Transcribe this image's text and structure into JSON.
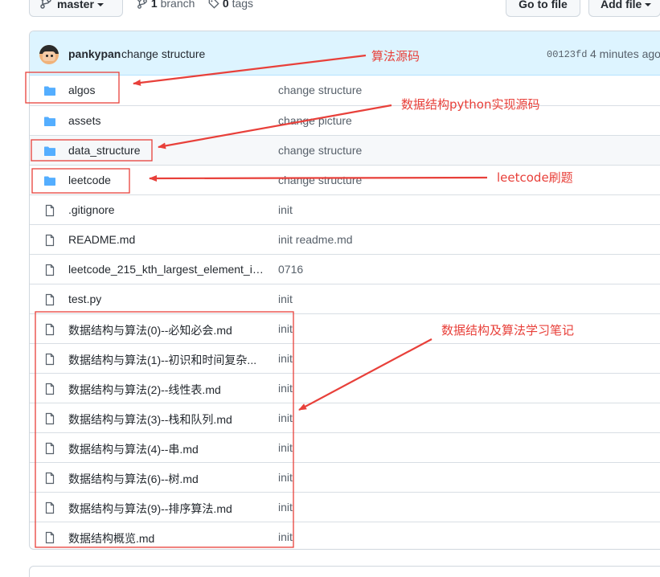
{
  "toolbar": {
    "branch": "master",
    "branch_count": "1",
    "branch_word": "branch",
    "tag_count": "0",
    "tag_word": "tags",
    "go_to_file": "Go to file",
    "add_file": "Add file"
  },
  "commit": {
    "author": "pankypan",
    "message": "change structure",
    "sha": "00123fd",
    "time": "4 minutes ago"
  },
  "files": [
    {
      "name": "algos",
      "type": "dir",
      "message": "change structure"
    },
    {
      "name": "assets",
      "type": "dir",
      "message": "change picture"
    },
    {
      "name": "data_structure",
      "type": "dir",
      "message": "change structure"
    },
    {
      "name": "leetcode",
      "type": "dir",
      "message": "change structure"
    },
    {
      "name": ".gitignore",
      "type": "file",
      "message": "init"
    },
    {
      "name": "README.md",
      "type": "file",
      "message": "init readme.md"
    },
    {
      "name": "leetcode_215_kth_largest_element_in_...",
      "type": "file",
      "message": "0716"
    },
    {
      "name": "test.py",
      "type": "file",
      "message": "init"
    },
    {
      "name": "数据结构与算法(0)--必知必会.md",
      "type": "file",
      "message": "init"
    },
    {
      "name": "数据结构与算法(1)--初识和时间复杂...",
      "type": "file",
      "message": "init"
    },
    {
      "name": "数据结构与算法(2)--线性表.md",
      "type": "file",
      "message": "init"
    },
    {
      "name": "数据结构与算法(3)--栈和队列.md",
      "type": "file",
      "message": "init"
    },
    {
      "name": "数据结构与算法(4)--串.md",
      "type": "file",
      "message": "init"
    },
    {
      "name": "数据结构与算法(6)--树.md",
      "type": "file",
      "message": "init"
    },
    {
      "name": "数据结构与算法(9)--排序算法.md",
      "type": "file",
      "message": "init"
    },
    {
      "name": "数据结构概览.md",
      "type": "file",
      "message": "init"
    }
  ],
  "annotations": {
    "color": "#e8403a",
    "algos": "算法源码",
    "data_structure": "数据结构python实现源码",
    "leetcode": "leetcode刷题",
    "notes": "数据结构及算法学习笔记"
  },
  "colors": {
    "folder": "#54aeff",
    "file_icon": "#57606a",
    "commit_bg": "#ddf4ff",
    "border": "#d0d7de"
  }
}
